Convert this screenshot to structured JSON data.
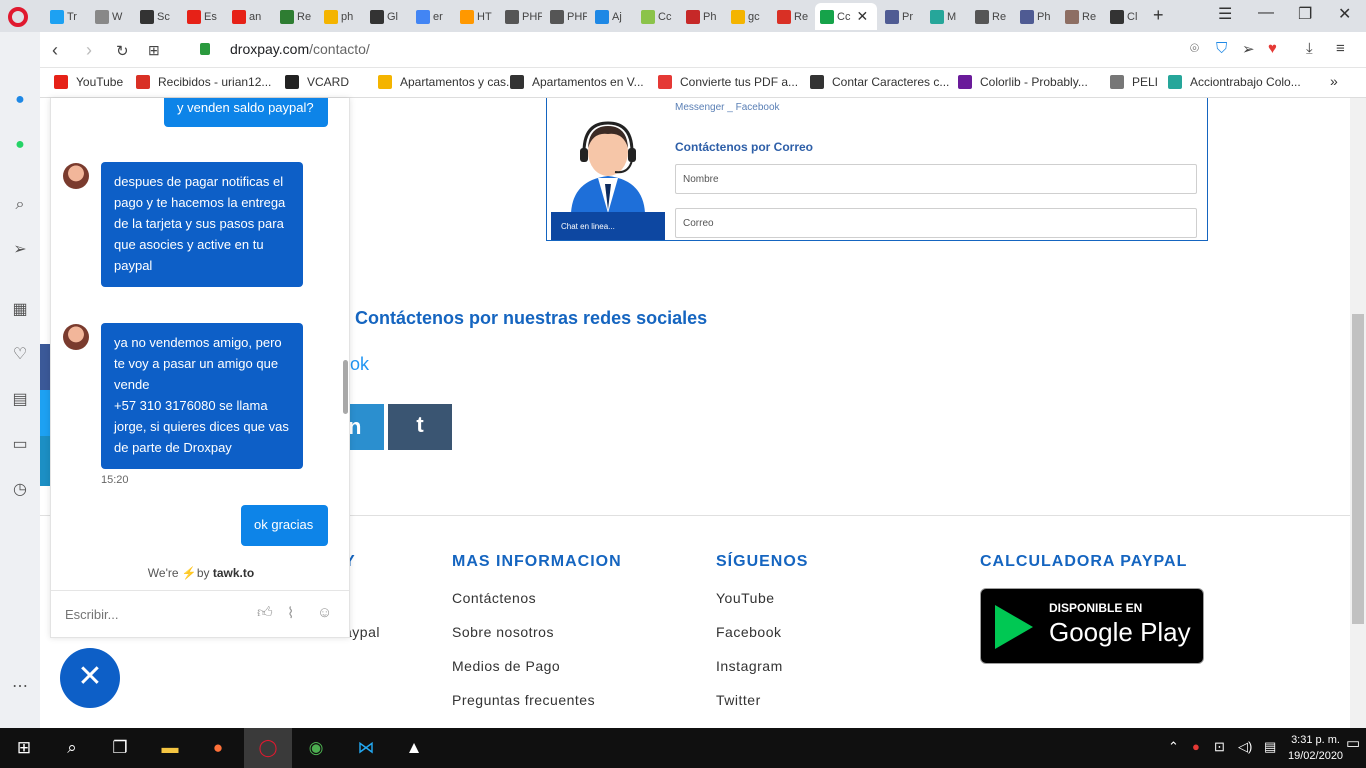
{
  "browser": {
    "tabs": [
      {
        "label": "Tr",
        "color": "#1da1f2"
      },
      {
        "label": "W",
        "color": "#888888"
      },
      {
        "label": "Sc",
        "color": "#333333"
      },
      {
        "label": "Es",
        "color": "#e62117"
      },
      {
        "label": "an",
        "color": "#e62117"
      },
      {
        "label": "Re",
        "color": "#2e7d32"
      },
      {
        "label": "ph",
        "color": "#f4b400"
      },
      {
        "label": "Gl",
        "color": "#333333"
      },
      {
        "label": "er",
        "color": "#4285f4"
      },
      {
        "label": "HT",
        "color": "#ff9800"
      },
      {
        "label": "PHP cc",
        "color": "#555555"
      },
      {
        "label": "PHP im",
        "color": "#555555"
      },
      {
        "label": "Aj",
        "color": "#1e88e5"
      },
      {
        "label": "Cc",
        "color": "#8bc34a"
      },
      {
        "label": "Ph",
        "color": "#c62828"
      },
      {
        "label": "gc",
        "color": "#f4b400"
      },
      {
        "label": "Re",
        "color": "#d93025"
      },
      {
        "label": "Cc",
        "color": "#16a34a"
      },
      {
        "label": "Pr",
        "color": "#4f5b93"
      },
      {
        "label": "M",
        "color": "#26a69a"
      },
      {
        "label": "Re",
        "color": "#555555"
      },
      {
        "label": "Ph",
        "color": "#4f5b93"
      },
      {
        "label": "Re",
        "color": "#8d6e63"
      },
      {
        "label": "Cl",
        "color": "#333333"
      }
    ],
    "url_domain": "droxpay.com",
    "url_path": "/contacto/",
    "bookmarks": [
      {
        "label": "YouTube",
        "color": "#e62117"
      },
      {
        "label": "Recibidos - urian12...",
        "color": "#d93025"
      },
      {
        "label": "VCARD",
        "color": "#222222"
      },
      {
        "label": "Apartamentos y cas...",
        "color": "#f4b400"
      },
      {
        "label": "Apartamentos en V...",
        "color": "#333333"
      },
      {
        "label": "Convierte tus PDF a...",
        "color": "#e53935"
      },
      {
        "label": "Contar Caracteres c...",
        "color": "#333333"
      },
      {
        "label": "Colorlib - Probably...",
        "color": "#6a1b9a"
      },
      {
        "label": "PELI",
        "color": "#777777"
      },
      {
        "label": "Acciontrabajo Colo...",
        "color": "#26a69a"
      }
    ],
    "bookmarks_more": "»"
  },
  "contact_image": {
    "messenger_line": "Messenger _ Facebook",
    "mail_title": "Contáctenos por Correo",
    "field_name": "Nombre",
    "field_email": "Correo",
    "chat_label": "Chat en linea..."
  },
  "social": {
    "title": "e Contáctenos por nuestras redes sociales",
    "link_fragment": "ok",
    "linkedin_glyph": "n",
    "tumblr_glyph": "t"
  },
  "footer": {
    "col1_title_fragment": "Y",
    "col1_link_fragment": "aypal",
    "mas_info_title": "MAS INFORMACION",
    "mas_info_links": [
      "Contáctenos",
      "Sobre nosotros",
      "Medios de Pago",
      "Preguntas frecuentes"
    ],
    "siguenos_title": "SÍGUENOS",
    "siguenos_links": [
      "YouTube",
      "Facebook",
      "Instagram",
      "Twitter"
    ],
    "calc_title": "CALCULADORA PAYPAL",
    "gplay_small": "DISPONIBLE EN",
    "gplay_big": "Google Play"
  },
  "chat": {
    "messages": [
      {
        "from": "visitor",
        "text": "y venden saldo paypal?"
      },
      {
        "from": "agent",
        "text": "despues de pagar notificas el pago y te hacemos la entrega de la tarjeta y sus pasos para que asocies y active en tu paypal"
      },
      {
        "from": "agent",
        "text": "ya no vendemos amigo, pero te voy a pasar un amigo que vende\n+57 310 3176080 se llama jorge, si quieres dices que vas de parte de Droxpay"
      },
      {
        "from": "visitor",
        "text": "ok gracias"
      }
    ],
    "time": "15:20",
    "powered_prefix": "We're",
    "powered_suffix": "by",
    "powered_brand": "tawk.to",
    "input_placeholder": "Escribir..."
  },
  "taskbar": {
    "time": "3:31 p. m.",
    "date": "19/02/2020"
  },
  "colors": {
    "chat_agent": "#0d5fc7",
    "chat_visitor": "#0d84e8",
    "heading_blue": "#1565c0"
  }
}
